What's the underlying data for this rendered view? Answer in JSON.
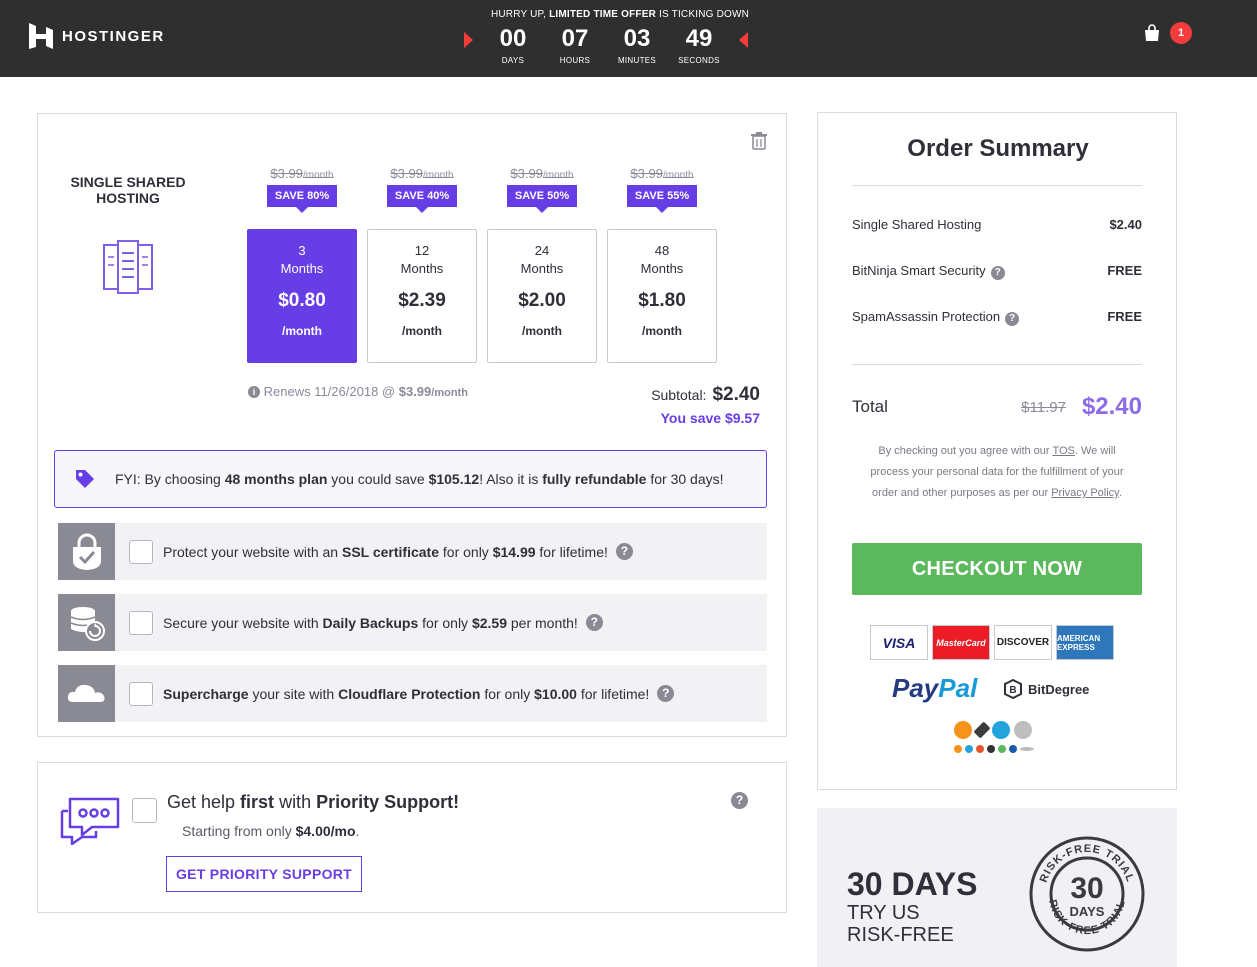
{
  "header": {
    "brand": "HOSTINGER",
    "offer_prefix": "HURRY UP, ",
    "offer_bold": "LIMITED TIME OFFER",
    "offer_suffix": " IS TICKING DOWN",
    "countdown": [
      {
        "value": "00",
        "label": "DAYS"
      },
      {
        "value": "07",
        "label": "HOURS"
      },
      {
        "value": "03",
        "label": "MINUTES"
      },
      {
        "value": "49",
        "label": "SECONDS"
      }
    ],
    "cart_count": "1"
  },
  "plan": {
    "title_line1": "SINGLE SHARED",
    "title_line2": "HOSTING",
    "options": [
      {
        "old_price": "$3.99",
        "old_unit": "/month",
        "save": "SAVE 80%",
        "duration_num": "3",
        "duration_unit": "Months",
        "price": "$0.80",
        "per": "/month",
        "active": true
      },
      {
        "old_price": "$3.99",
        "old_unit": "/month",
        "save": "SAVE 40%",
        "duration_num": "12",
        "duration_unit": "Months",
        "price": "$2.39",
        "per": "/month",
        "active": false
      },
      {
        "old_price": "$3.99",
        "old_unit": "/month",
        "save": "SAVE 50%",
        "duration_num": "24",
        "duration_unit": "Months",
        "price": "$2.00",
        "per": "/month",
        "active": false
      },
      {
        "old_price": "$3.99",
        "old_unit": "/month",
        "save": "SAVE 55%",
        "duration_num": "48",
        "duration_unit": "Months",
        "price": "$1.80",
        "per": "/month",
        "active": false
      }
    ],
    "renews_text": "Renews 11/26/2018 @ ",
    "renews_price": "$3.99",
    "renews_unit": "/month",
    "subtotal_label": "Subtotal:",
    "subtotal_value": "$2.40",
    "you_save": "You save $9.57"
  },
  "fyi": {
    "t1": "FYI: By choosing ",
    "b1": "48 months plan",
    "t2": " you could save ",
    "b2": "$105.12",
    "t3": "! Also it is ",
    "b3": "fully refundable",
    "t4": " for 30 days!"
  },
  "addons": [
    {
      "icon": "ssl-lock-icon",
      "t1": "Protect your website with an ",
      "b1": "SSL certificate",
      "t2": " for only ",
      "b2": "$14.99",
      "t3": " for lifetime!"
    },
    {
      "icon": "backup-database-icon",
      "t1": "Secure your website with ",
      "b1": "Daily Backups",
      "t2": " for only ",
      "b2": "$2.59",
      "t3": " per month!"
    },
    {
      "icon": "cloudflare-cloud-icon",
      "t1": "",
      "b1": "Supercharge",
      "t2": " your site with ",
      "b2": "Cloudflare Protection",
      "t3": " for only ",
      "b3": "$10.00",
      "t4": " for lifetime!"
    }
  ],
  "priority": {
    "t1": "Get help ",
    "b1": "first",
    "t2": " with ",
    "b2": "Priority Support!",
    "sub_text": "Starting from only ",
    "sub_price": "$4.00/mo",
    "sub_end": ".",
    "button": "GET PRIORITY SUPPORT"
  },
  "summary": {
    "title": "Order Summary",
    "items": [
      {
        "label": "Single Shared Hosting",
        "value": "$2.40",
        "help": false
      },
      {
        "label": "BitNinja Smart Security",
        "value": "FREE",
        "help": true
      },
      {
        "label": "SpamAssassin Protection",
        "value": "FREE",
        "help": true
      }
    ],
    "total_label": "Total",
    "total_old": "$11.97",
    "total_new": "$2.40",
    "note_1": "By checking out you agree with our ",
    "note_tos": "TOS",
    "note_2": ". We will process your personal data for the fulfillment of your order and other purposes as per our ",
    "note_privacy": "Privacy Policy",
    "note_3": ".",
    "checkout": "CHECKOUT NOW",
    "cards": [
      "VISA",
      "MasterCard",
      "DISCOVER",
      "AMERICAN EXPRESS"
    ],
    "paypal_a": "Pay",
    "paypal_b": "Pal",
    "bitdegree": "BitDegree"
  },
  "riskfree": {
    "big": "30 DAYS",
    "line1": "TRY US",
    "line2": "RISK-FREE",
    "seal_top": "RISK-FREE TRIAL",
    "seal_num": "30",
    "seal_days": "DAYS",
    "seal_bottom": "RISK-FREE TRIAL"
  },
  "colors": {
    "accent": "#673de6",
    "checkout": "#5cb85c",
    "alert": "#f53c3c",
    "header_bg": "#2f2f2f"
  }
}
